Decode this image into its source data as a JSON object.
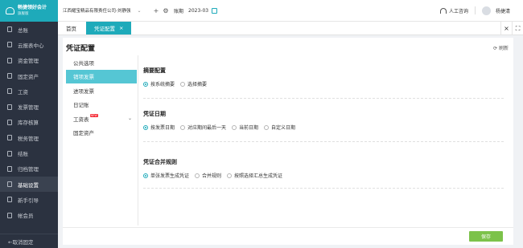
{
  "app": {
    "logo_line1": "畅捷领好会计",
    "logo_line2": "旗舰版"
  },
  "sidebar": {
    "items": [
      {
        "label": "总账",
        "icon": "ledger-icon"
      },
      {
        "label": "云报表中心",
        "icon": "cloud-report-icon"
      },
      {
        "label": "资金管理",
        "icon": "fund-icon"
      },
      {
        "label": "固定资产",
        "icon": "asset-icon"
      },
      {
        "label": "工资",
        "icon": "salary-icon"
      },
      {
        "label": "发票管理",
        "icon": "invoice-icon"
      },
      {
        "label": "库存核算",
        "icon": "inventory-icon"
      },
      {
        "label": "税务管理",
        "icon": "tax-icon"
      },
      {
        "label": "结账",
        "icon": "close-period-icon"
      },
      {
        "label": "归档管理",
        "icon": "archive-icon"
      },
      {
        "label": "基础设置",
        "icon": "settings-icon",
        "active": true
      },
      {
        "label": "新手引导",
        "icon": "guide-icon"
      },
      {
        "label": "帐会员",
        "icon": "member-icon"
      }
    ],
    "footer": "←取消固定"
  },
  "topbar": {
    "company": "江西耀宝精品有限责任公司-刘静强",
    "period_label": "账期",
    "period_value": "2023-03",
    "support": "人工咨询",
    "user": "杨捷清"
  },
  "tabs": [
    {
      "label": "首页",
      "active": false
    },
    {
      "label": "凭证配置",
      "active": true,
      "close": "×"
    }
  ],
  "tabs_right": {
    "close": "×",
    "fullscreen": "⛶"
  },
  "page": {
    "title": "凭证配置",
    "refresh": "⟳ 刷新",
    "subnav": [
      {
        "label": "公共选项",
        "active": false
      },
      {
        "label": "销项发票",
        "active": true
      },
      {
        "label": "进项发票",
        "active": false
      },
      {
        "label": "日记账",
        "active": false
      },
      {
        "label": "工资表",
        "active": false,
        "badge": "NEW",
        "chevron": "⌄"
      },
      {
        "label": "固定资产",
        "active": false
      }
    ],
    "sections": [
      {
        "title": "摘要配置",
        "options": [
          {
            "label": "按系统摘要",
            "checked": true
          },
          {
            "label": "选择摘要",
            "checked": false
          }
        ]
      },
      {
        "title": "凭证日期",
        "options": [
          {
            "label": "按发票日期",
            "checked": true
          },
          {
            "label": "对应期间最后一天",
            "checked": false
          },
          {
            "label": "当前日期",
            "checked": false
          },
          {
            "label": "自定义日期",
            "checked": false
          }
        ]
      },
      {
        "title": "凭证合并规则",
        "options": [
          {
            "label": "单张发票生成凭证",
            "checked": true
          },
          {
            "label": "合并规则",
            "checked": false
          },
          {
            "label": "按照选择汇总生成凭证",
            "checked": false
          }
        ]
      }
    ],
    "save_label": "保存"
  }
}
